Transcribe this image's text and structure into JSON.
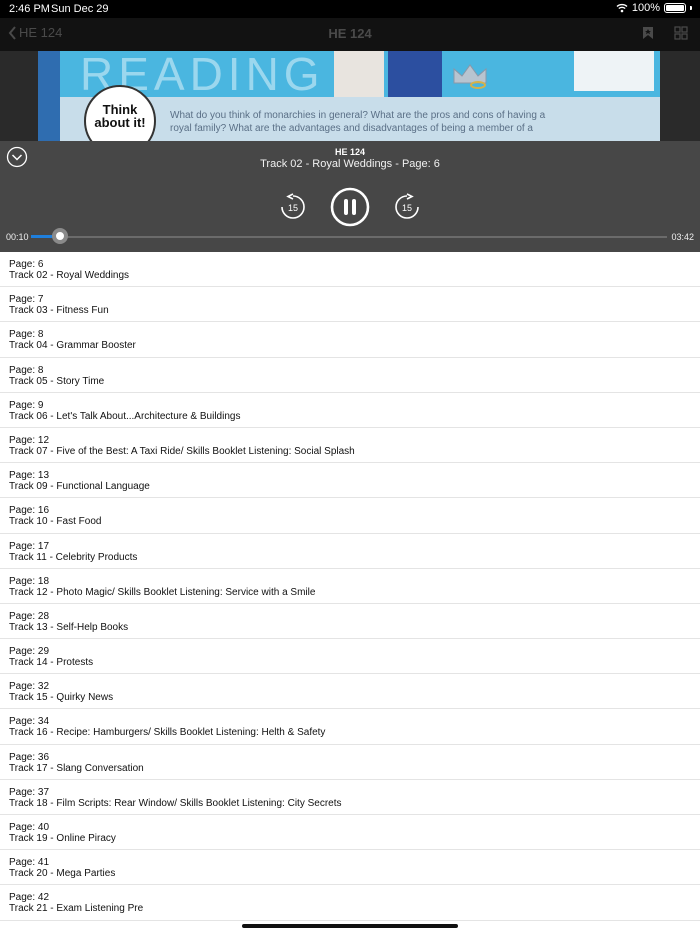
{
  "status_bar": {
    "time": "2:46 PM",
    "date": "Sun Dec 29",
    "battery": "100%"
  },
  "nav": {
    "back_label": "HE 124",
    "title": "HE 124"
  },
  "preview": {
    "heading": "READING",
    "think_text": "Think about it!",
    "paragraph": "What do you think of monarchies in general? What are the pros and cons of having a royal family? What are the advantages and disadvantages of being a member of a"
  },
  "player": {
    "title": "HE 124",
    "subtitle": "Track 02 - Royal Weddings - Page: 6",
    "rewind_label": "15",
    "forward_label": "15",
    "elapsed": "00:10",
    "duration": "03:42",
    "progress": 0.045,
    "accent": "#1f7fdc"
  },
  "tracks": [
    {
      "page": "Page: 6",
      "track": "Track 02 - Royal Weddings"
    },
    {
      "page": "Page: 7",
      "track": "Track 03 - Fitness Fun"
    },
    {
      "page": "Page: 8",
      "track": "Track 04 - Grammar Booster"
    },
    {
      "page": "Page: 8",
      "track": "Track 05 - Story Time"
    },
    {
      "page": "Page: 9",
      "track": "Track 06 - Let's Talk About...Architecture & Buildings"
    },
    {
      "page": "Page: 12",
      "track": "Track 07 - Five of the Best: A Taxi Ride/ Skills Booklet Listening: Social Splash"
    },
    {
      "page": "Page: 13",
      "track": "Track 09 - Functional Language"
    },
    {
      "page": "Page: 16",
      "track": "Track 10 - Fast Food"
    },
    {
      "page": "Page: 17",
      "track": "Track 11 - Celebrity Products"
    },
    {
      "page": "Page: 18",
      "track": "Track 12 - Photo Magic/ Skills Booklet Listening: Service with a Smile"
    },
    {
      "page": "Page: 28",
      "track": "Track 13 - Self-Help Books"
    },
    {
      "page": "Page: 29",
      "track": "Track 14 - Protests"
    },
    {
      "page": "Page: 32",
      "track": "Track 15 - Quirky News"
    },
    {
      "page": "Page: 34",
      "track": "Track 16 - Recipe: Hamburgers/ Skills Booklet Listening: Helth & Safety"
    },
    {
      "page": "Page: 36",
      "track": "Track 17 - Slang Conversation"
    },
    {
      "page": "Page: 37",
      "track": "Track 18 - Film Scripts: Rear Window/ Skills Booklet Listening: City Secrets"
    },
    {
      "page": "Page: 40",
      "track": "Track 19 - Online Piracy"
    },
    {
      "page": "Page: 41",
      "track": "Track 20 - Mega Parties"
    },
    {
      "page": "Page: 42",
      "track": "Track 21 - Exam Listening Pre"
    }
  ]
}
